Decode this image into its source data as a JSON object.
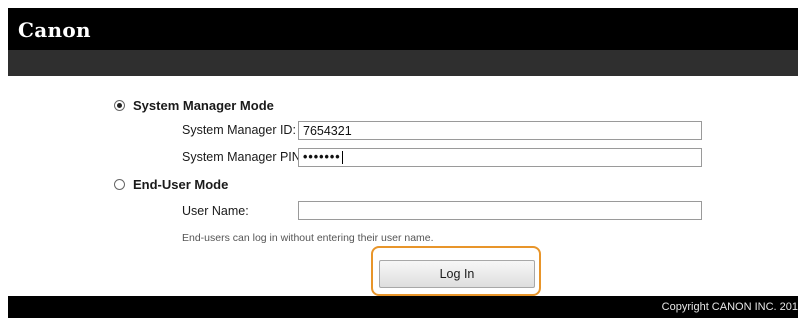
{
  "brand": {
    "logo_text": "Canon"
  },
  "modes": {
    "system_manager": {
      "label": "System Manager Mode",
      "selected": true,
      "id_label": "System Manager ID:",
      "id_value": "7654321",
      "pin_label": "System Manager PIN:",
      "pin_value": "•••••••"
    },
    "end_user": {
      "label": "End-User Mode",
      "selected": false,
      "user_label": "User Name:",
      "user_value": "",
      "note": "End-users can log in without entering their user name."
    }
  },
  "actions": {
    "login_label": "Log In"
  },
  "footer": {
    "copyright": "Copyright CANON INC. 201"
  },
  "colors": {
    "highlight": "#e8952a",
    "topbar": "#000000",
    "subbar": "#2f2f2f"
  }
}
